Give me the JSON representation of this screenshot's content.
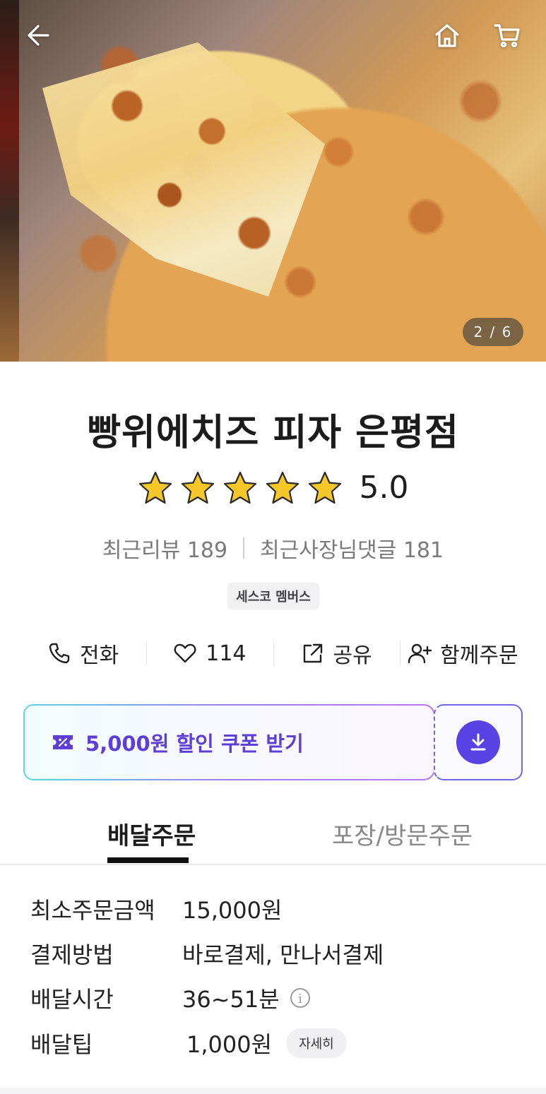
{
  "hero": {
    "image_name": "pizza-photo",
    "page_indicator": "2 / 6",
    "back_icon": "back-arrow-icon",
    "home_icon": "home-icon",
    "cart_icon": "cart-icon"
  },
  "store": {
    "name": "빵위에치즈 피자 은평점",
    "rating": "5.0",
    "stars": 5,
    "recent_reviews": "최근리뷰 189",
    "owner_replies": "최근사장님댓글 181",
    "badge": "세스코 멤버스"
  },
  "actions": [
    {
      "label": "전화",
      "icon": "phone-icon"
    },
    {
      "label": "114",
      "icon": "heart-icon"
    },
    {
      "label": "공유",
      "icon": "share-icon"
    },
    {
      "label": "함께주문",
      "icon": "add-user-icon"
    }
  ],
  "coupon": {
    "text": "5,000원 할인 쿠폰 받기",
    "icon": "coupon-icon",
    "download_icon": "download-icon",
    "accent": "#5a43e4"
  },
  "tabs": [
    {
      "label": "배달주문",
      "active": true
    },
    {
      "label": "포장/방문주문",
      "active": false
    }
  ],
  "info": {
    "min_order_label": "최소주문금액",
    "min_order_value": "15,000원",
    "payment_label": "결제방법",
    "payment_value": "바로결제, 만나서결제",
    "delivery_time_label": "배달시간",
    "delivery_time_value": "36~51분",
    "delivery_tip_label": "배달팁",
    "delivery_tip_value": "1,000원",
    "detail_button": "자세히"
  }
}
